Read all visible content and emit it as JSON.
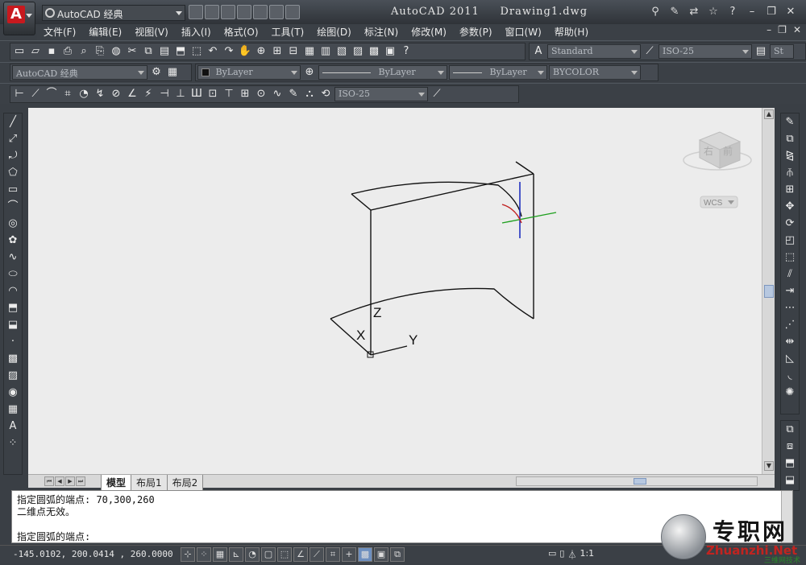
{
  "title": {
    "app": "AutoCAD 2011",
    "document": "Drawing1.dwg",
    "workspace": "AutoCAD 经典"
  },
  "menu": [
    "文件(F)",
    "编辑(E)",
    "视图(V)",
    "插入(I)",
    "格式(O)",
    "工具(T)",
    "绘图(D)",
    "标注(N)",
    "修改(M)",
    "参数(P)",
    "窗口(W)",
    "帮助(H)"
  ],
  "toolbars": {
    "text_style": "Standard",
    "dim_style": "ISO-25",
    "dim_style_2": "ISO-25",
    "extra_style": "St",
    "workspace_combo": "AutoCAD 经典",
    "layer_color": "ByLayer",
    "linetype": "ByLayer",
    "lineweight": "ByLayer",
    "plot_style": "BYCOLOR"
  },
  "viewcube": {
    "face": "右",
    "face_2": "前",
    "wcs_label": "WCS"
  },
  "axes": {
    "x": "X",
    "y": "Y",
    "z": "Z"
  },
  "tabs": [
    {
      "label": "模型",
      "active": true
    },
    {
      "label": "布局1",
      "active": false
    },
    {
      "label": "布局2",
      "active": false
    }
  ],
  "command_line": {
    "line1": "指定圆弧的端点: 70,300,260",
    "line2": "二维点无效。",
    "line3": "指定圆弧的端点:"
  },
  "status": {
    "coordinates": "-145.0102,  200.0414 , 260.0000",
    "scale": "1:1"
  },
  "watermark": {
    "chinese": "专职网",
    "english": "Zhuanzhi.Net",
    "sub": "三维网技术"
  }
}
